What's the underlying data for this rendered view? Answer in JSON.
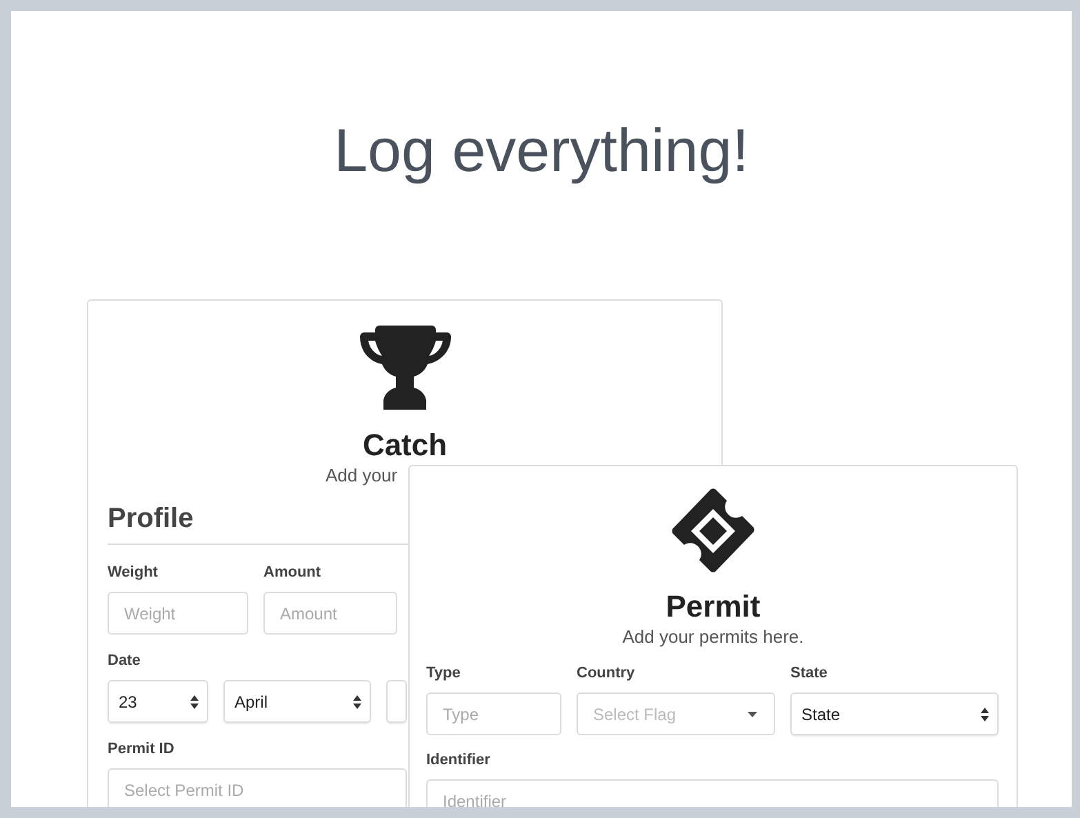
{
  "heading": "Log everything!",
  "catch_card": {
    "title": "Catch",
    "subtitle": "Add your",
    "section": "Profile",
    "rows": [
      {
        "fields": [
          {
            "label": "Weight",
            "kind": "input",
            "placeholder": "Weight"
          },
          {
            "label": "Amount",
            "kind": "input",
            "placeholder": "Amount"
          }
        ]
      },
      {
        "fields": [
          {
            "label": "Date",
            "kind": "select",
            "value": "23"
          },
          {
            "kind": "select",
            "value": "April"
          },
          {
            "kind": "select"
          }
        ]
      },
      {
        "fields": [
          {
            "label": "Permit ID",
            "kind": "input",
            "placeholder": "Select Permit ID"
          }
        ]
      }
    ]
  },
  "permit_card": {
    "title": "Permit",
    "subtitle": "Add your permits here.",
    "rows": [
      {
        "fields": [
          {
            "label": "Type",
            "kind": "input",
            "placeholder": "Type"
          },
          {
            "label": "Country",
            "kind": "dropdown",
            "placeholder": "Select Flag"
          },
          {
            "label": "State",
            "kind": "select",
            "value": "State"
          }
        ]
      },
      {
        "fields": [
          {
            "label": "Identifier",
            "kind": "input",
            "placeholder": "Identifier"
          }
        ]
      }
    ]
  }
}
